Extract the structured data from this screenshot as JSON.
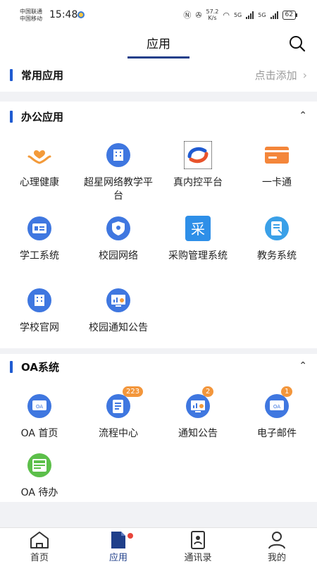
{
  "status": {
    "carrier_1": "中国联通",
    "carrier_2": "中国移动",
    "time": "15:48",
    "speed": "57.2",
    "speed_unit": "K/s",
    "net_1": "5G",
    "net_2": "5G",
    "battery": "62"
  },
  "header": {
    "title": "应用",
    "search_icon": "search-icon"
  },
  "common": {
    "title": "常用应用",
    "add_label": "点击添加",
    "chevron": "›"
  },
  "office": {
    "title": "办公应用",
    "collapse": "⌃",
    "items": [
      {
        "label": "心理健康",
        "icon": "heart-hands-icon"
      },
      {
        "label": "超星网络教学平台",
        "icon": "building-icon"
      },
      {
        "label": "真内控平台",
        "icon": "swirl-logo-icon"
      },
      {
        "label": "一卡通",
        "icon": "card-icon"
      },
      {
        "label": "学工系统",
        "icon": "id-card-icon"
      },
      {
        "label": "校园网络",
        "icon": "shield-icon"
      },
      {
        "label": "采购管理系统",
        "icon": "purchase-icon"
      },
      {
        "label": "教务系统",
        "icon": "document-icon"
      },
      {
        "label": "学校官网",
        "icon": "building-icon"
      },
      {
        "label": "校园通知公告",
        "icon": "monitor-chart-icon"
      }
    ]
  },
  "oa": {
    "title": "OA系统",
    "collapse": "⌃",
    "items": [
      {
        "label": "OA 首页",
        "icon": "oa-icon",
        "badge": ""
      },
      {
        "label": "流程中心",
        "icon": "clipboard-icon",
        "badge": "223"
      },
      {
        "label": "通知公告",
        "icon": "monitor-chart-icon",
        "badge": "2"
      },
      {
        "label": "电子邮件",
        "icon": "oa-icon",
        "badge": "1"
      },
      {
        "label": "OA 待办",
        "icon": "news-icon",
        "badge": ""
      }
    ]
  },
  "tabs": [
    {
      "label": "首页",
      "icon": "home-icon"
    },
    {
      "label": "应用",
      "icon": "apps-doc-icon"
    },
    {
      "label": "通讯录",
      "icon": "contacts-icon"
    },
    {
      "label": "我的",
      "icon": "profile-icon"
    }
  ],
  "colors": {
    "accent": "#1f5bd1",
    "brand": "#1f3f8a",
    "badge": "#f3963b",
    "icon_blue": "#3f77e0"
  }
}
